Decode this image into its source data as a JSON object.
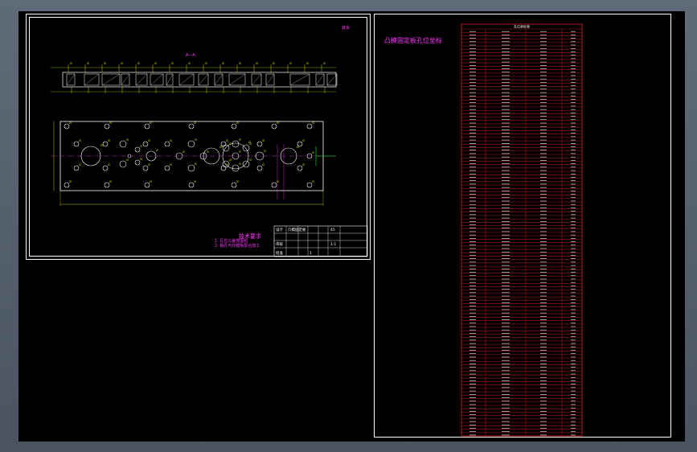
{
  "colors": {
    "background": "#000000",
    "app_chrome": "#56606d",
    "frame": "#ffffff",
    "annotation": "#ff33ff",
    "table_lines": "#ff2020",
    "dimension": "#ffff00",
    "geometry": "#ffffff",
    "centerline": "#00ff00"
  },
  "sheet1": {
    "view_label": "A—A",
    "corner_mark": "其余",
    "notes_title": "技术要求",
    "note_1": "1. 孔位公差按图纸",
    "note_2": "2. 销孔与凹模板配合加工",
    "title_block": {
      "cell_name": "凸模固定板",
      "cell_material": "45",
      "cell_scale": "1:1",
      "cell_qty": "1",
      "cell_designer": "设计",
      "cell_check": "审核",
      "cell_approve": "批准"
    }
  },
  "sheet2": {
    "title": "凸模固定板孔位坐标",
    "table_header": "孔位坐标表",
    "row_count": 120
  }
}
